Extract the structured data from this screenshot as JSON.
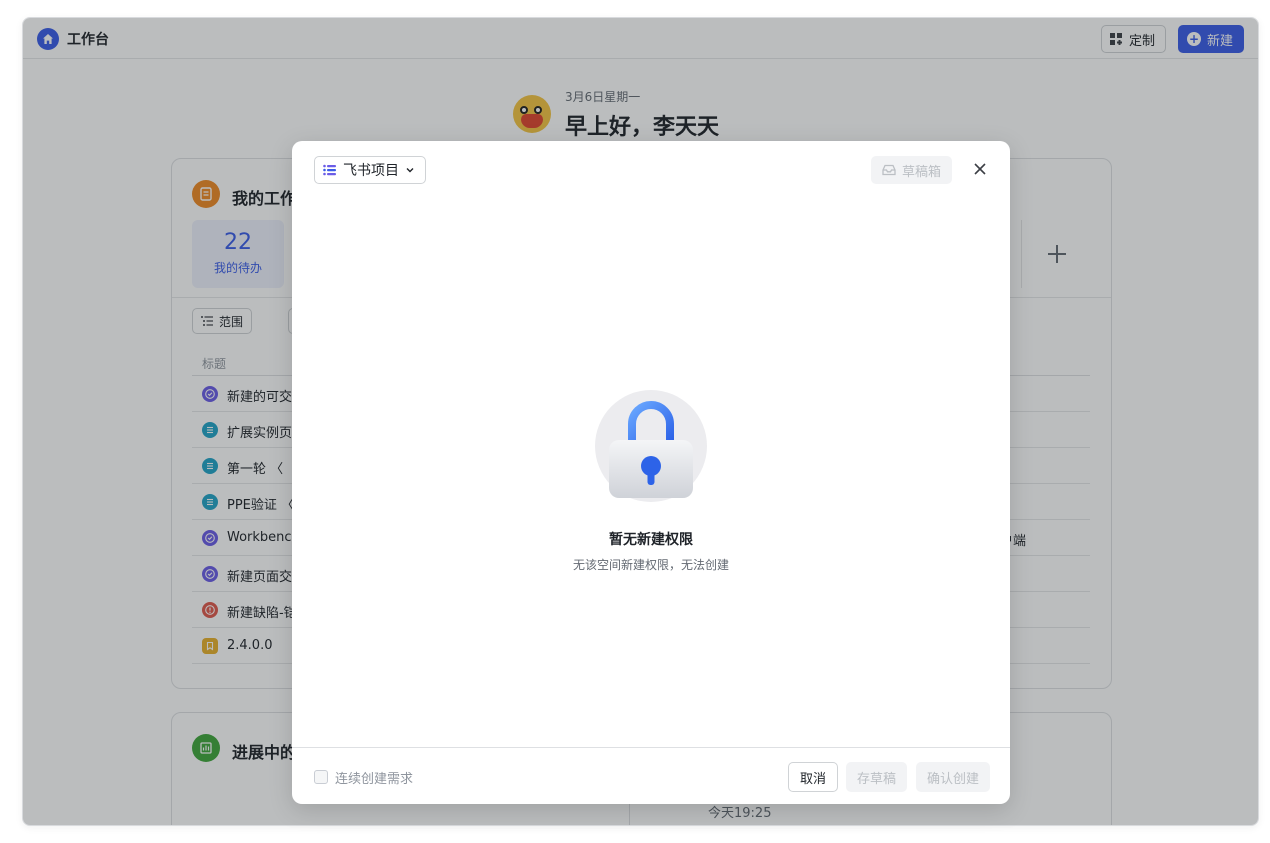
{
  "app": {
    "title": "工作台"
  },
  "toolbar": {
    "customize_label": "定制",
    "new_label": "新建"
  },
  "greeting": {
    "date": "3月6日星期一",
    "text": "早上好，李天天"
  },
  "my_work": {
    "title": "我的工作",
    "stat": {
      "value": "22",
      "label": "我的待办"
    },
    "range_label": "范围",
    "column_title": "标题",
    "rows": [
      {
        "title": "新建的可交",
        "type": "task",
        "right": ""
      },
      {
        "title": "扩展实例页",
        "type": "story",
        "right": ""
      },
      {
        "title": "第一轮  〈",
        "type": "story",
        "right": ""
      },
      {
        "title": "PPE验证  〈",
        "type": "story",
        "right": ""
      },
      {
        "title": "Workbench",
        "type": "task",
        "right": "户端"
      },
      {
        "title": "新建页面交",
        "type": "task",
        "right": ""
      },
      {
        "title": "新建缺陷-铠",
        "type": "bug",
        "right": "]"
      },
      {
        "title": "2.4.0.0",
        "type": "version",
        "right": "]"
      }
    ]
  },
  "progress": {
    "title": "进展中的",
    "time": "今天19:25"
  },
  "modal": {
    "project_label": "飞书项目",
    "draft_box_label": "草稿箱",
    "empty_title": "暂无新建权限",
    "empty_desc": "无该空间新建权限，无法创建",
    "continuous_label": "连续创建需求",
    "cancel_label": "取消",
    "save_draft_label": "存草稿",
    "confirm_label": "确认创建"
  },
  "colors": {
    "accent": "#3a5ce8",
    "task": "#6b5ce7",
    "story": "#21a4c8",
    "bug": "#e05a4d",
    "version": "#e8b12c",
    "card_icon_work": "#f08a24",
    "card_icon_progress": "#3fa63b"
  }
}
